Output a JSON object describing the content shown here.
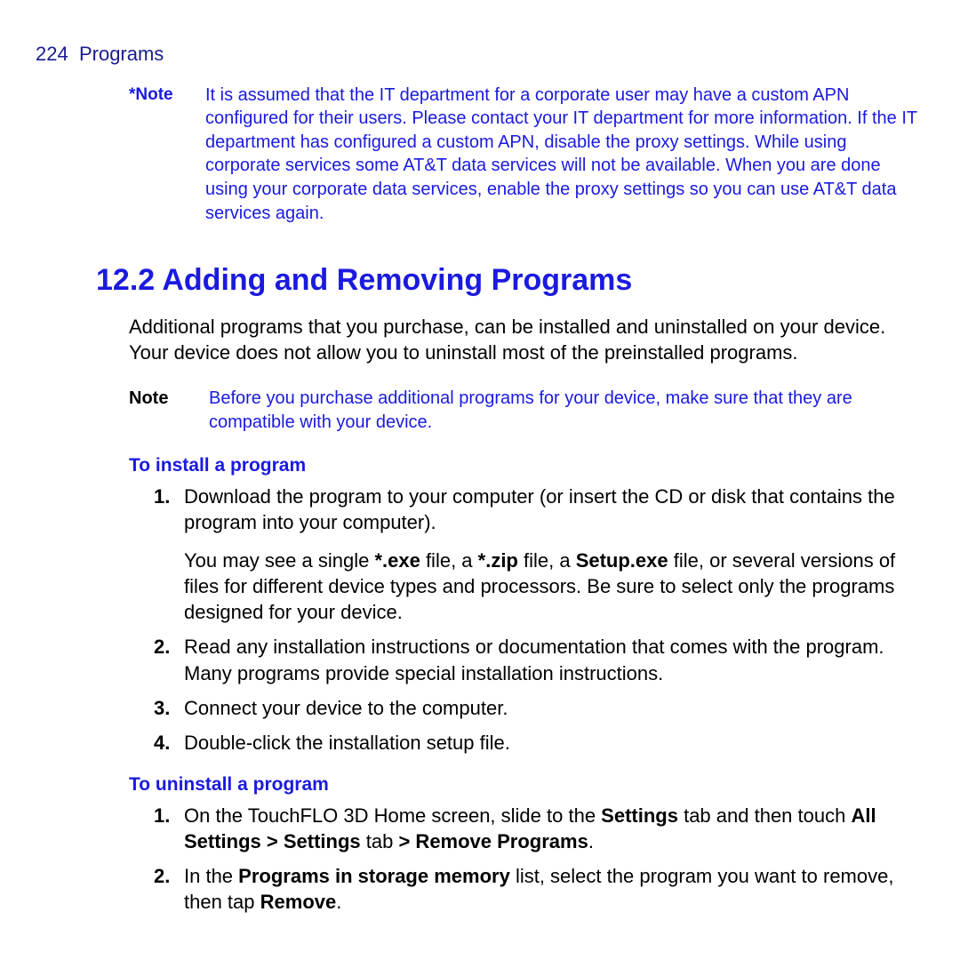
{
  "header": {
    "page_num": "224",
    "chapter": "Programs"
  },
  "note1": {
    "label": "*Note",
    "body": "It is assumed that the IT department for a corporate user may have a custom APN configured for their users. Please contact your IT department for more information. If the IT department has configured a custom APN, disable the proxy settings. While using corporate services some AT&T data services will not be available. When you are done using your corporate data services, enable the proxy settings so you can use AT&T data services again."
  },
  "section": {
    "heading": "12.2  Adding and Removing Programs",
    "para": "Additional programs that you purchase, can be installed and uninstalled on your device. Your device does not allow you to uninstall most of the preinstalled programs."
  },
  "note2": {
    "label": "Note",
    "body": "Before you purchase additional programs for your device, make sure that they are compatible with your device."
  },
  "install": {
    "heading": "To install a program",
    "items": [
      {
        "num": "1.",
        "body_a": "Download the program to your computer (or insert the CD or disk that contains the program into your computer).",
        "body_b_pre": "You may see a single ",
        "body_b_b1": "*.exe",
        "body_b_mid1": " file, a ",
        "body_b_b2": "*.zip",
        "body_b_mid2": " file, a ",
        "body_b_b3": "Setup.exe",
        "body_b_post": " file, or several versions of files for different device types and processors. Be sure to select only the programs designed for your device."
      },
      {
        "num": "2.",
        "body_a": "Read any installation instructions or documentation that comes with the program. Many programs provide special installation instructions."
      },
      {
        "num": "3.",
        "body_a": "Connect your device to the computer."
      },
      {
        "num": "4.",
        "body_a": "Double-click the installation setup file."
      }
    ]
  },
  "uninstall": {
    "heading": "To uninstall a program",
    "items": [
      {
        "num": "1.",
        "pre": "On the TouchFLO 3D Home screen, slide to the ",
        "b1": "Settings",
        "mid1": " tab and then touch ",
        "b2": "All Settings > Settings",
        "mid2": " tab ",
        "b3": "> Remove Programs",
        "post": "."
      },
      {
        "num": "2.",
        "pre": "In the ",
        "b1": "Programs in storage memory",
        "mid1": " list, select the program you want to remove, then tap ",
        "b2": "Remove",
        "post": "."
      }
    ]
  }
}
